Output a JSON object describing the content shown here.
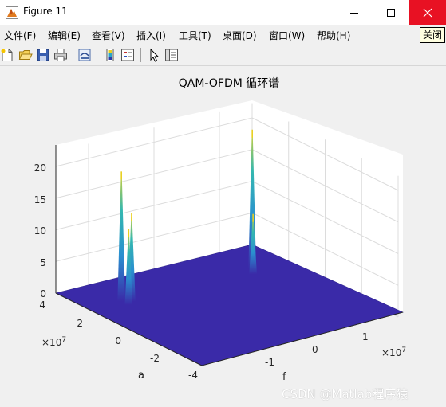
{
  "window": {
    "title": "Figure 11",
    "close_tooltip": "关闭"
  },
  "menu": [
    "文件(F)",
    "编辑(E)",
    "查看(V)",
    "插入(I)",
    "工具(T)",
    "桌面(D)",
    "窗口(W)",
    "帮助(H)"
  ],
  "toolbar": {
    "buttons": [
      "new-figure-icon",
      "open-file-icon",
      "save-icon",
      "print-icon",
      "link-plot-icon",
      "colorbar-icon",
      "legend-icon",
      "edit-plot-icon",
      "property-inspector-icon"
    ]
  },
  "chart_data": {
    "type": "surface",
    "title": "QAM-OFDM 循环谱",
    "xlabel": "f",
    "ylabel": "a",
    "x_exponent": "×10^7",
    "y_exponent": "×10^7",
    "x_ticks": [
      "-1",
      "0",
      "1"
    ],
    "y_ticks": [
      "4",
      "2",
      "0",
      "-2",
      "-4"
    ],
    "z_ticks": [
      "0",
      "5",
      "10",
      "15",
      "20"
    ],
    "xlim": [
      -1.5,
      1.5
    ],
    "ylim": [
      -4,
      4
    ],
    "zlim": [
      0,
      20
    ],
    "grid": true,
    "surface_color": "#3a2aa8",
    "peaks": [
      {
        "f": -1.0,
        "a": 2.2,
        "z": 20.5
      },
      {
        "f": -0.9,
        "a": 2.0,
        "z": 14.0
      },
      {
        "f": -1.0,
        "a": 1.8,
        "z": 12.0
      },
      {
        "f": 1.0,
        "a": 2.2,
        "z": 22.0
      },
      {
        "f": 0.9,
        "a": 1.8,
        "z": 9.5
      }
    ]
  },
  "watermark": "CSDN @Matlab程序猿"
}
